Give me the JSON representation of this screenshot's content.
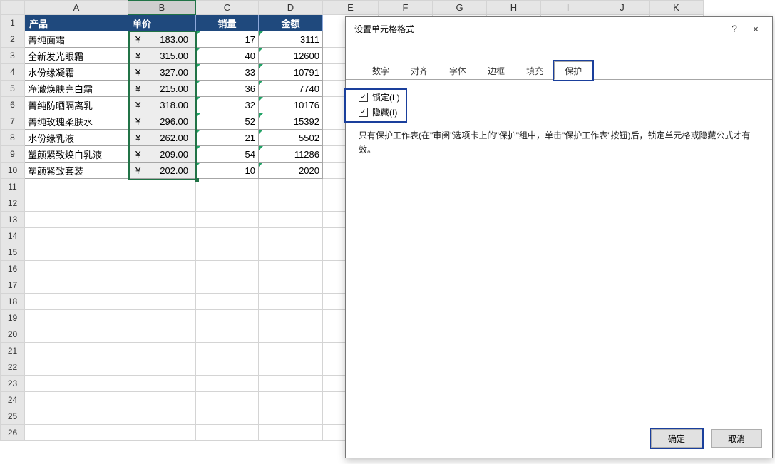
{
  "columns": [
    "A",
    "B",
    "C",
    "D",
    "E",
    "F",
    "G",
    "H",
    "I",
    "J",
    "K"
  ],
  "row_count": 26,
  "headers": {
    "A": "产品",
    "B": "单价",
    "C": "销量",
    "D": "金额"
  },
  "rows": [
    {
      "a": "菁纯面霜",
      "b": "183.00",
      "c": 17,
      "d": 3111
    },
    {
      "a": "全新发光眼霜",
      "b": "315.00",
      "c": 40,
      "d": 12600
    },
    {
      "a": "水份缘凝霜",
      "b": "327.00",
      "c": 33,
      "d": 10791
    },
    {
      "a": "净澈焕肤亮白霜",
      "b": "215.00",
      "c": 36,
      "d": 7740
    },
    {
      "a": "菁纯防晒隔离乳",
      "b": "318.00",
      "c": 32,
      "d": 10176
    },
    {
      "a": "菁纯玫瑰柔肤水",
      "b": "296.00",
      "c": 52,
      "d": 15392
    },
    {
      "a": "水份缘乳液",
      "b": "262.00",
      "c": 21,
      "d": 5502
    },
    {
      "a": "塑颜紧致焕白乳液",
      "b": "209.00",
      "c": 54,
      "d": 11286
    },
    {
      "a": "塑颜紧致套装",
      "b": "202.00",
      "c": 10,
      "d": 2020
    }
  ],
  "currency": "¥",
  "selected_range": "B2:B10",
  "chart_data": {
    "type": "table",
    "columns": [
      "产品",
      "单价",
      "销量",
      "金额"
    ],
    "data": [
      [
        "菁纯面霜",
        183.0,
        17,
        3111
      ],
      [
        "全新发光眼霜",
        315.0,
        40,
        12600
      ],
      [
        "水份缘凝霜",
        327.0,
        33,
        10791
      ],
      [
        "净澈焕肤亮白霜",
        215.0,
        36,
        7740
      ],
      [
        "菁纯防晒隔离乳",
        318.0,
        32,
        10176
      ],
      [
        "菁纯玫瑰柔肤水",
        296.0,
        52,
        15392
      ],
      [
        "水份缘乳液",
        262.0,
        21,
        5502
      ],
      [
        "塑颜紧致焕白乳液",
        209.0,
        54,
        11286
      ],
      [
        "塑颜紧致套装",
        202.0,
        10,
        2020
      ]
    ]
  },
  "dialog": {
    "title": "设置单元格格式",
    "help": "?",
    "close": "×",
    "tabs": [
      "数字",
      "对齐",
      "字体",
      "边框",
      "填充",
      "保护"
    ],
    "active_tab": 5,
    "checks": {
      "lock": "锁定(L)",
      "hide": "隐藏(I)"
    },
    "lock_checked": true,
    "hide_checked": true,
    "note": "只有保护工作表(在\"审阅\"选项卡上的\"保护\"组中，单击\"保护工作表\"按钮)后，锁定单元格或隐藏公式才有效。",
    "ok": "确定",
    "cancel": "取消"
  }
}
